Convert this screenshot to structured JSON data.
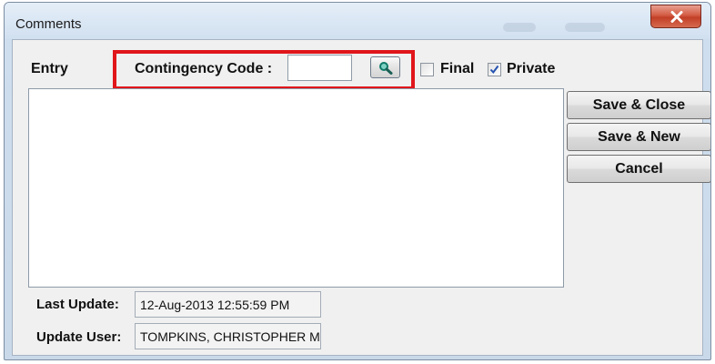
{
  "window": {
    "title": "Comments"
  },
  "form": {
    "entry_label": "Entry",
    "contingency_code_label": "Contingency Code :",
    "contingency_code_value": "",
    "final_label": "Final",
    "final_checked": false,
    "private_label": "Private",
    "private_checked": true,
    "comment_text": ""
  },
  "buttons": {
    "save_close": "Save & Close",
    "save_new": "Save & New",
    "cancel": "Cancel"
  },
  "info": {
    "last_update_label": "Last Update:",
    "last_update_value": "12-Aug-2013 12:55:59 PM",
    "update_user_label": "Update User:",
    "update_user_value": "TOMPKINS, CHRISTOPHER M"
  },
  "highlight_color": "#e0161b",
  "icons": {
    "lookup": "search-icon",
    "close": "close-icon",
    "check": "checkmark-icon"
  }
}
